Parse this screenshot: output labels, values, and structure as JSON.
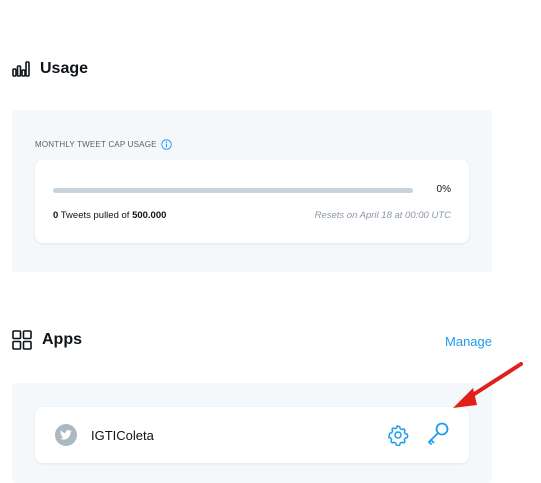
{
  "usage": {
    "title": "Usage",
    "cap_label": "MONTHLY TWEET CAP USAGE",
    "progress_percent": 0,
    "percent_label": "0%",
    "pulled_count": "0",
    "pulled_text": " Tweets pulled of ",
    "cap_total": "500.000",
    "resets_text": "Resets on April 18 at 00:00 UTC"
  },
  "apps": {
    "title": "Apps",
    "manage_label": "Manage",
    "items": [
      {
        "name": "IGTIColeta"
      }
    ]
  },
  "colors": {
    "accent": "#1d9bf0",
    "annotation_arrow": "#e0201b"
  }
}
